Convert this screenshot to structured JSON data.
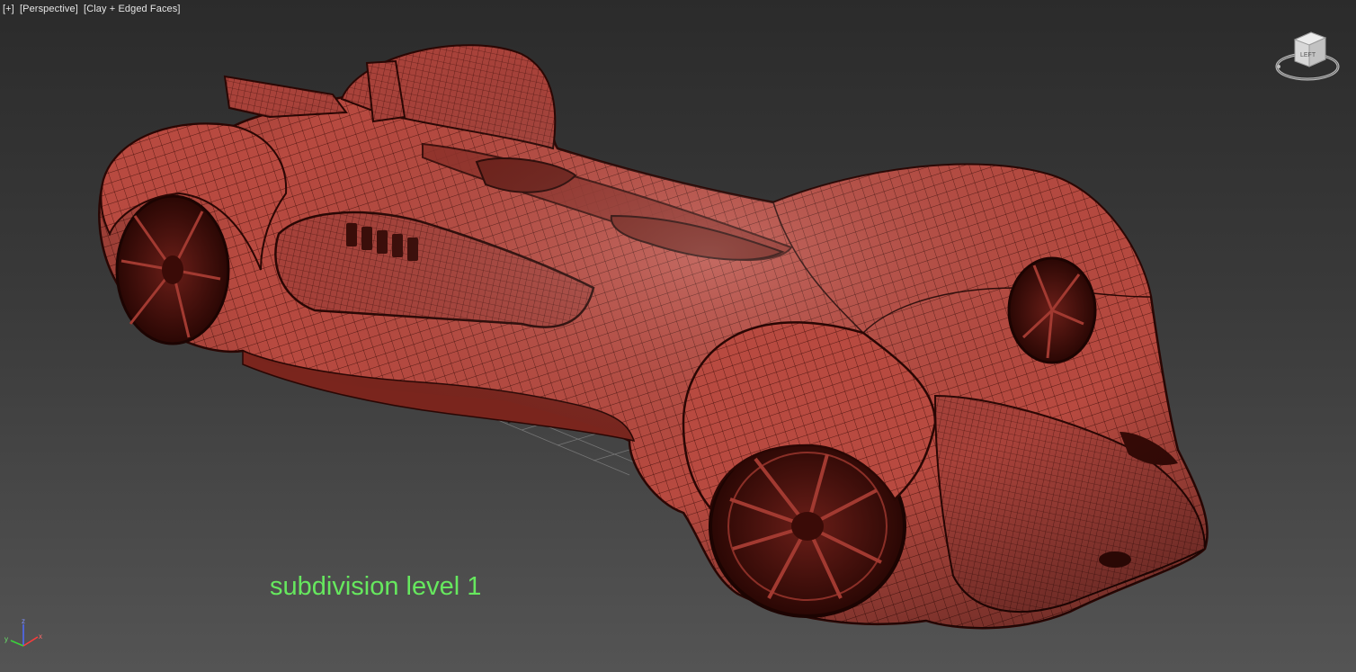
{
  "viewport": {
    "labels": [
      "[+]",
      "[Perspective]",
      "[Clay + Edged Faces]"
    ]
  },
  "caption": "subdivision level 1",
  "viewcube": {
    "face_label": "LEFT",
    "icon": "viewcube-icon"
  },
  "axis_gizmo": {
    "x": "x",
    "y": "y",
    "z": "z",
    "icon": "axis-tripod-icon"
  },
  "colors": {
    "clay": "#b84a40",
    "wire": "#3a0b07",
    "caption": "#66e85e",
    "background_top": "#2b2b2b",
    "background_bottom": "#545454"
  }
}
